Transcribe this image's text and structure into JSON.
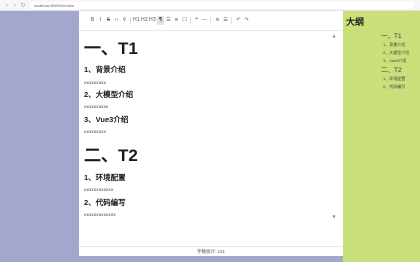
{
  "browser": {
    "back_glyph": "‹",
    "forward_glyph": "›",
    "reload_glyph": "↻",
    "url": "localhost:8080/#/editor"
  },
  "toolbar": [
    {
      "name": "bold",
      "glyph": "B"
    },
    {
      "name": "italic",
      "glyph": "I"
    },
    {
      "name": "strikethrough",
      "glyph": "S"
    },
    {
      "name": "code",
      "glyph": "‹›"
    },
    {
      "name": "link",
      "glyph": "⚲"
    },
    {
      "name": "h1",
      "glyph": "H1"
    },
    {
      "name": "h2",
      "glyph": "H2"
    },
    {
      "name": "h3",
      "glyph": "H3"
    },
    {
      "name": "paragraph",
      "glyph": "¶"
    },
    {
      "name": "bullet-list",
      "glyph": "☰"
    },
    {
      "name": "ordered-list",
      "glyph": "≡"
    },
    {
      "name": "task-list",
      "glyph": "☐"
    },
    {
      "name": "blockquote",
      "glyph": "❝"
    },
    {
      "name": "horizontal-rule",
      "glyph": "—"
    },
    {
      "name": "align-left",
      "glyph": "≡"
    },
    {
      "name": "align-center",
      "glyph": "☰"
    },
    {
      "name": "undo",
      "glyph": "↶"
    },
    {
      "name": "redo",
      "glyph": "↷"
    }
  ],
  "document": {
    "h1_1": "一、T1",
    "h3_1": "1、背景介绍",
    "p_1": "xxxxxxxxx",
    "h3_2": "2、大模型介绍",
    "p_2": "xxxxxxxxxx",
    "h3_3": "3、Vue3介绍",
    "p_3": "xxxxxxxxx",
    "h1_2": "二、T2",
    "h3_4": "1、环境配置",
    "p_4": "xxxxxxxxxxxx",
    "h3_5": "2、代码编写",
    "p_5": "xxxxxxxxxxxxx"
  },
  "status": {
    "text": "字数统计: 121"
  },
  "outline": {
    "title": "大纲",
    "items": [
      {
        "level": 1,
        "label": "一、T1"
      },
      {
        "level": 2,
        "label": "1、背景介绍"
      },
      {
        "level": 2,
        "label": "2、大模型介绍"
      },
      {
        "level": 2,
        "label": "3、Vue3介绍"
      },
      {
        "level": 1,
        "label": "二、T2"
      },
      {
        "level": 2,
        "label": "1、环境配置"
      },
      {
        "level": 2,
        "label": "2、代码编写"
      }
    ]
  },
  "colors": {
    "left_panel": "#a4a6cd",
    "right_panel": "#c9df7a",
    "active_button": "#e2e2e2"
  },
  "scrollbar": {
    "up_glyph": "▲",
    "down_glyph": "▼"
  }
}
